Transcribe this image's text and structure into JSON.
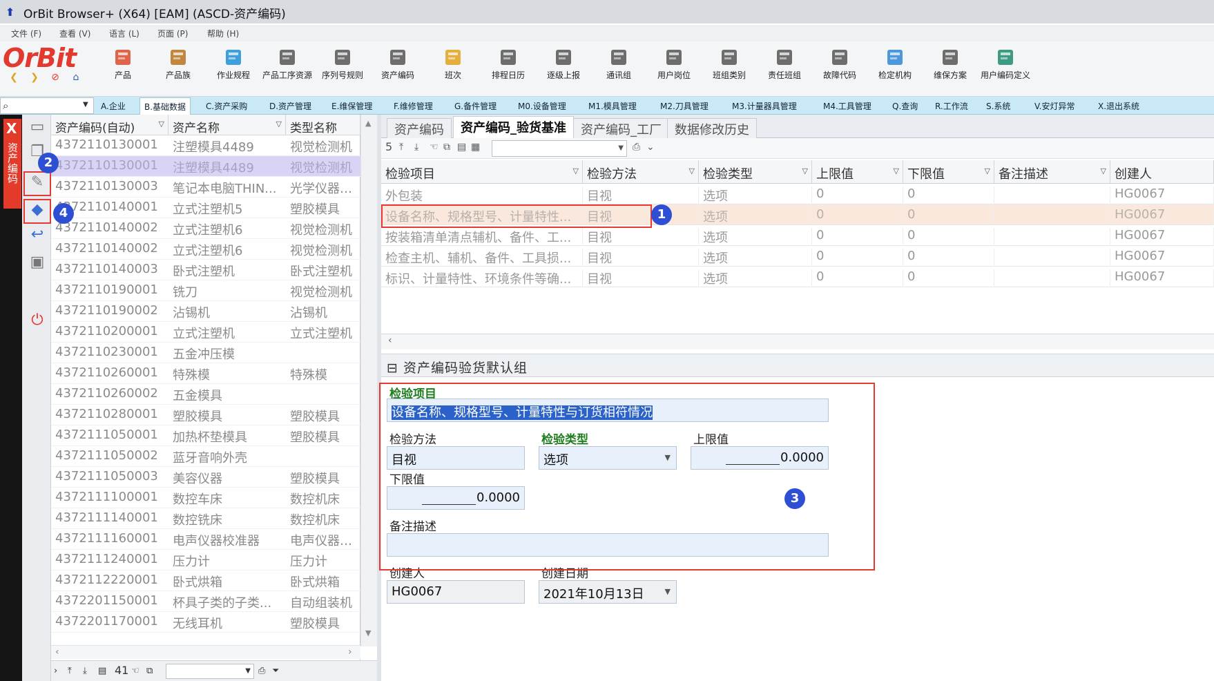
{
  "window": {
    "title": "OrBit Browser+ (X64) [EAM] (ASCD-资产编码)"
  },
  "menu": [
    "文件 (F)",
    "查看 (V)",
    "语言 (L)",
    "页面 (P)",
    "帮助 (H)"
  ],
  "logo": {
    "text": "OrBit"
  },
  "toolbar": [
    {
      "label": "产品",
      "icon": "product-icon",
      "color": "#d94a2b"
    },
    {
      "label": "产品族",
      "icon": "product-family-icon",
      "color": "#b8731f"
    },
    {
      "label": "作业规程",
      "icon": "gear-icon",
      "color": "#1f8fd6"
    },
    {
      "label": "产品工序资源",
      "icon": "process-resource-icon",
      "color": "#555555"
    },
    {
      "label": "序列号规则",
      "icon": "serial-rule-icon",
      "color": "#555555"
    },
    {
      "label": "资产编码",
      "icon": "asset-code-icon",
      "color": "#555555"
    },
    {
      "label": "班次",
      "icon": "shift-icon",
      "color": "#e0a21b"
    },
    {
      "label": "排程日历",
      "icon": "calendar-icon",
      "color": "#555555"
    },
    {
      "label": "逐级上报",
      "icon": "escalation-icon",
      "color": "#555555"
    },
    {
      "label": "通讯组",
      "icon": "comm-group-icon",
      "color": "#555555"
    },
    {
      "label": "用户岗位",
      "icon": "user-post-icon",
      "color": "#555555"
    },
    {
      "label": "班组类别",
      "icon": "team-type-icon",
      "color": "#555555"
    },
    {
      "label": "责任班组",
      "icon": "responsible-team-icon",
      "color": "#555555"
    },
    {
      "label": "故障代码",
      "icon": "fault-code-icon",
      "color": "#555555"
    },
    {
      "label": "检定机构",
      "icon": "user-icon",
      "color": "#2f86d6"
    },
    {
      "label": "维保方案",
      "icon": "maintenance-plan-icon",
      "color": "#555555"
    },
    {
      "label": "用户编码定义",
      "icon": "book-icon",
      "color": "#1d8a6e"
    }
  ],
  "search": {
    "placeholder": ""
  },
  "modules": [
    "A.企业",
    "B.基础数据",
    "C.资产采购",
    "D.资产管理",
    "E.维保管理",
    "F.维修管理",
    "G.备件管理",
    "M0.设备管理",
    "M1.模具管理",
    "M2.刀具管理",
    "M3.计量器具管理",
    "M4.工具管理",
    "Q.查询",
    "R.工作流",
    "S.系统",
    "V.安灯异常",
    "X.退出系统"
  ],
  "active_module": "B.基础数据",
  "side_tab": {
    "close": "X",
    "label": "资产编码"
  },
  "left_grid": {
    "headers": [
      "资产编码(自动)",
      "资产名称",
      "类型名称"
    ],
    "rows": [
      [
        "4372110130001",
        "注塑模具4489",
        "视觉检测机"
      ],
      [
        "4372110130001",
        "注塑模具4489",
        "视觉检测机"
      ],
      [
        "4372110130003",
        "笔记本电脑THIN...",
        "光学仪器校准"
      ],
      [
        "4372110140001",
        "立式注塑机5",
        "塑胶模具"
      ],
      [
        "4372110140002",
        "立式注塑机6",
        "视觉检测机"
      ],
      [
        "4372110140002",
        "立式注塑机6",
        "视觉检测机"
      ],
      [
        "4372110140003",
        "卧式注塑机",
        "卧式注塑机"
      ],
      [
        "4372110190001",
        "铣刀",
        "视觉检测机"
      ],
      [
        "4372110190002",
        "沾锡机",
        "沾锡机"
      ],
      [
        "4372110200001",
        "立式注塑机",
        "立式注塑机"
      ],
      [
        "4372110230001",
        "五金冲压模",
        ""
      ],
      [
        "4372110260001",
        "特殊模",
        "特殊模"
      ],
      [
        "4372110260002",
        "五金模具",
        ""
      ],
      [
        "4372110280001",
        "塑胶模具",
        "塑胶模具"
      ],
      [
        "4372111050001",
        "加热杯垫模具",
        "塑胶模具"
      ],
      [
        "4372111050002",
        "蓝牙音响外壳",
        ""
      ],
      [
        "4372111050003",
        "美容仪器",
        "塑胶模具"
      ],
      [
        "4372111100001",
        "数控车床",
        "数控机床"
      ],
      [
        "4372111140001",
        "数控铣床",
        "数控机床"
      ],
      [
        "4372111160001",
        "电声仪器校准器",
        "电声仪器校准"
      ],
      [
        "4372111240001",
        "压力计",
        "压力计"
      ],
      [
        "4372112220001",
        "卧式烘箱",
        "卧式烘箱"
      ],
      [
        "4372201150001",
        "杯具子类的子类...",
        "自动组装机"
      ],
      [
        "4372201170001",
        "无线耳机",
        "塑胶模具"
      ]
    ],
    "selected_row": 1,
    "record_count": "41"
  },
  "right_tabs": [
    "资产编码",
    "资产编码_验货基准",
    "资产编码_工厂",
    "数据修改历史"
  ],
  "active_right_tab": "资产编码_验货基准",
  "right_toolbar": {
    "count": "5"
  },
  "right_grid": {
    "headers": [
      "检验项目",
      "检验方法",
      "检验类型",
      "上限值",
      "下限值",
      "备注描述",
      "创建人"
    ],
    "rows": [
      [
        "外包装",
        "目视",
        "选项",
        "0",
        "0",
        "",
        "HG0067"
      ],
      [
        "设备名称、规格型号、计量特性...",
        "目视",
        "选项",
        "0",
        "0",
        "",
        "HG0067"
      ],
      [
        "按装箱清单清点辅机、备件、工...",
        "目视",
        "选项",
        "0",
        "0",
        "",
        "HG0067"
      ],
      [
        "检查主机、辅机、备件、工具损...",
        "目视",
        "选项",
        "0",
        "0",
        "",
        "HG0067"
      ],
      [
        "标识、计量特性、环境条件等确...",
        "目视",
        "选项",
        "0",
        "0",
        "",
        "HG0067"
      ]
    ],
    "selected_row": 1
  },
  "group": {
    "title": "资产编码验货默认组"
  },
  "form": {
    "inspection_item": {
      "label": "检验项目",
      "value": "设备名称、规格型号、计量特性与订货相符情况"
    },
    "method": {
      "label": "检验方法",
      "value": "目视"
    },
    "type": {
      "label": "检验类型",
      "value": "选项"
    },
    "upper": {
      "label": "上限值",
      "value": "0.0000"
    },
    "lower": {
      "label": "下限值",
      "value": "0.0000"
    },
    "remark": {
      "label": "备注描述",
      "value": ""
    },
    "creator": {
      "label": "创建人",
      "value": "HG0067"
    },
    "created_date": {
      "label": "创建日期",
      "value": "2021年10月13日"
    }
  },
  "annotations": [
    "1",
    "2",
    "3",
    "4"
  ]
}
